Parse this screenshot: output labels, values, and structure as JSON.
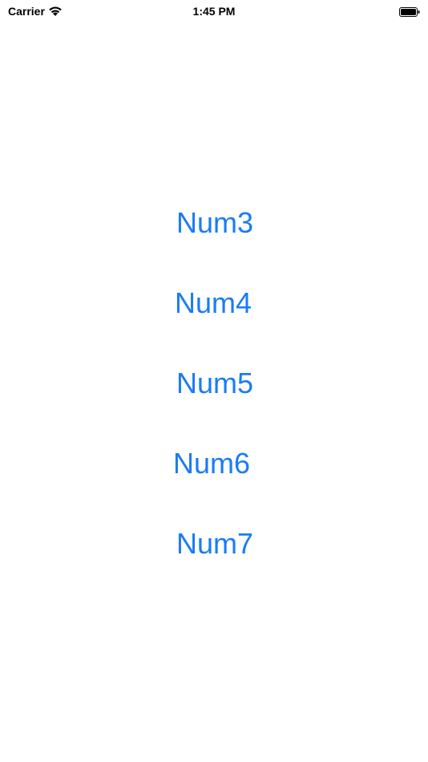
{
  "status_bar": {
    "carrier": "Carrier",
    "time": "1:45 PM",
    "wifi_icon": "wifi-icon",
    "battery_icon": "battery-icon"
  },
  "buttons": [
    {
      "label": "Num3"
    },
    {
      "label": "Num4"
    },
    {
      "label": "Num5"
    },
    {
      "label": "Num6"
    },
    {
      "label": "Num7"
    }
  ],
  "colors": {
    "accent": "#1a7cf5"
  }
}
